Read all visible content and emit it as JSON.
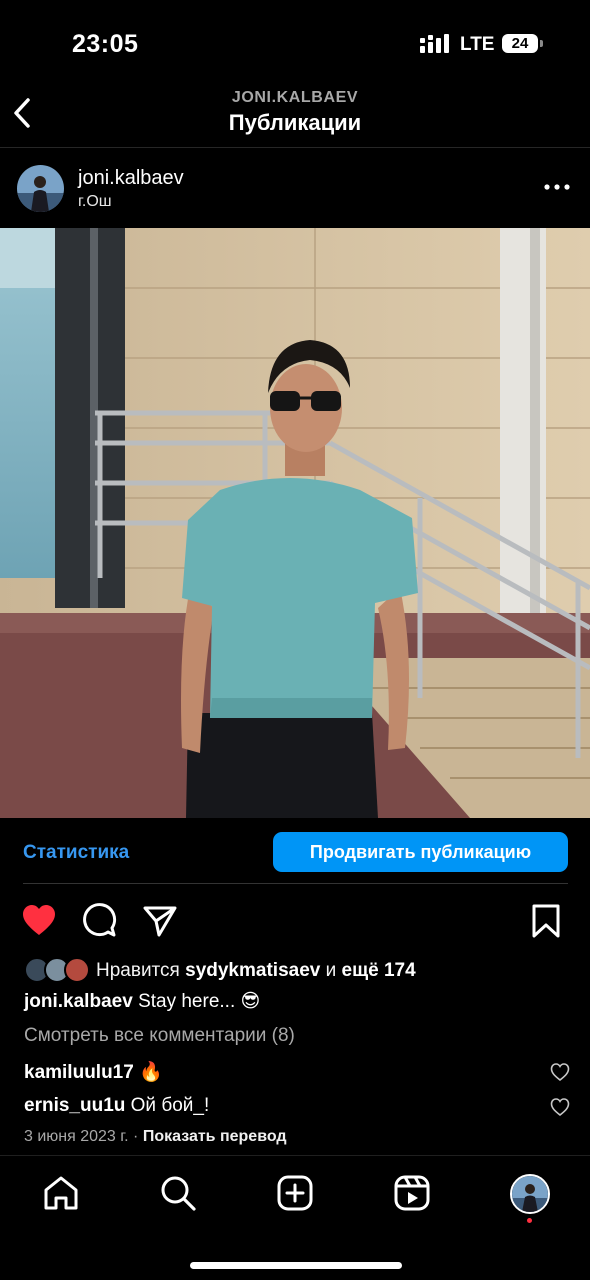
{
  "status_bar": {
    "time": "23:05",
    "network": "LTE",
    "battery": "24"
  },
  "header": {
    "subtitle": "JONI.KALBAEV",
    "title": "Публикации"
  },
  "post": {
    "username": "joni.kalbaev",
    "location": "г.Ош"
  },
  "insights": {
    "stats_label": "Статистика",
    "promote_label": "Продвигать публикацию"
  },
  "likes": {
    "prefix": "Нравится",
    "user": "sydykmatisaev",
    "joiner": "и",
    "more": "ещё 174"
  },
  "caption": {
    "user": "joni.kalbaev",
    "text": "Stay here... 😎"
  },
  "view_comments": "Смотреть все комментарии (8)",
  "comments": [
    {
      "user": "kamiluulu17",
      "text": "🔥"
    },
    {
      "user": "ernis_uu1u",
      "text": "Ой бой_!"
    }
  ],
  "meta": {
    "date": "3 июня 2023 г.",
    "separator": "·",
    "translate": "Показать перевод"
  },
  "colors": {
    "accent": "#0095f6",
    "like_red": "#ff3040",
    "shirt": "#6ab1b4",
    "wall": "#d4bfa0"
  },
  "icons": [
    "back-icon",
    "more-icon",
    "heart-icon",
    "comment-icon",
    "share-icon",
    "bookmark-icon",
    "home-icon",
    "search-icon",
    "create-icon",
    "reels-icon"
  ]
}
